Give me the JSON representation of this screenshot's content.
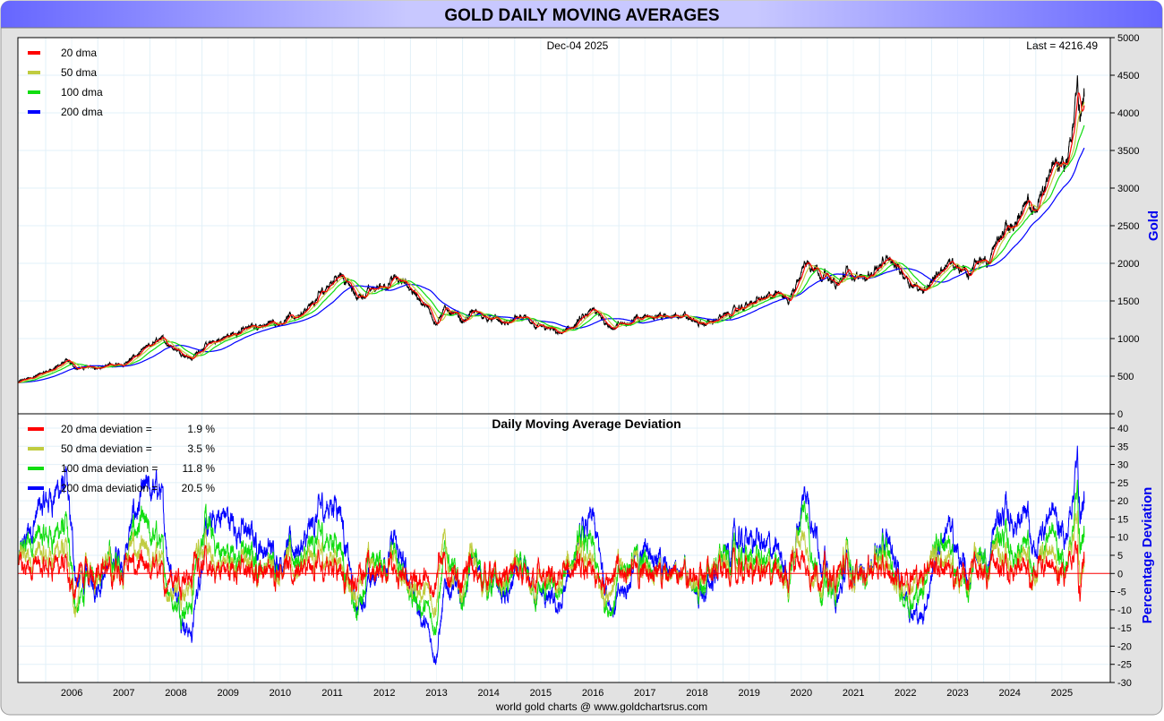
{
  "title": "GOLD DAILY MOVING AVERAGES",
  "footer": "world gold charts @ www.goldchartsrus.com",
  "chart_data": [
    {
      "type": "line",
      "title": "",
      "date_label": "Dec-04  2025",
      "last_label": "Last = 4216.49",
      "ylabel": "Gold",
      "ylim": [
        0,
        5000
      ],
      "yticks": [
        0,
        500,
        1000,
        1500,
        2000,
        2500,
        3000,
        3500,
        4000,
        4500,
        5000
      ],
      "xticks": [
        "2006",
        "2007",
        "2008",
        "2009",
        "2010",
        "2011",
        "2012",
        "2013",
        "2014",
        "2015",
        "2016",
        "2017",
        "2018",
        "2019",
        "2020",
        "2021",
        "2022",
        "2023",
        "2024",
        "2025"
      ],
      "xlim": [
        2005.48,
        2025.95
      ],
      "legend": [
        {
          "label": "20 dma",
          "color": "#ff0000"
        },
        {
          "label": "50 dma",
          "color": "#c0cc40"
        },
        {
          "label": "100 dma",
          "color": "#10dd10"
        },
        {
          "label": "200 dma",
          "color": "#0000ff"
        }
      ],
      "price_color": "#000000",
      "price_keypoints": [
        [
          2005.48,
          425
        ],
        [
          2006.0,
          550
        ],
        [
          2006.4,
          700
        ],
        [
          2006.6,
          600
        ],
        [
          2007.0,
          630
        ],
        [
          2007.5,
          660
        ],
        [
          2008.0,
          900
        ],
        [
          2008.2,
          1000
        ],
        [
          2008.8,
          730
        ],
        [
          2009.0,
          880
        ],
        [
          2009.9,
          1150
        ],
        [
          2010.5,
          1230
        ],
        [
          2011.0,
          1350
        ],
        [
          2011.65,
          1900
        ],
        [
          2011.95,
          1550
        ],
        [
          2012.7,
          1780
        ],
        [
          2013.0,
          1680
        ],
        [
          2013.5,
          1230
        ],
        [
          2013.7,
          1400
        ],
        [
          2014.0,
          1230
        ],
        [
          2014.2,
          1350
        ],
        [
          2014.9,
          1180
        ],
        [
          2015.0,
          1280
        ],
        [
          2015.9,
          1060
        ],
        [
          2016.5,
          1360
        ],
        [
          2016.9,
          1150
        ],
        [
          2017.7,
          1330
        ],
        [
          2017.95,
          1260
        ],
        [
          2018.1,
          1350
        ],
        [
          2018.6,
          1180
        ],
        [
          2019.0,
          1290
        ],
        [
          2019.7,
          1520
        ],
        [
          2020.2,
          1600
        ],
        [
          2020.25,
          1480
        ],
        [
          2020.6,
          2050
        ],
        [
          2021.2,
          1700
        ],
        [
          2021.4,
          1900
        ],
        [
          2021.6,
          1780
        ],
        [
          2022.2,
          2050
        ],
        [
          2022.8,
          1630
        ],
        [
          2023.3,
          2000
        ],
        [
          2023.75,
          1830
        ],
        [
          2023.85,
          2050
        ],
        [
          2024.1,
          2030
        ],
        [
          2024.3,
          2350
        ],
        [
          2024.85,
          2750
        ],
        [
          2024.95,
          2620
        ],
        [
          2025.3,
          3300
        ],
        [
          2025.6,
          3350
        ],
        [
          2025.8,
          4350
        ],
        [
          2025.85,
          4000
        ],
        [
          2025.93,
          4216.49
        ]
      ]
    },
    {
      "type": "line",
      "title": "Daily Moving Average Deviation",
      "ylabel": "Percentage Deviation",
      "ylim": [
        -30,
        40
      ],
      "yticks": [
        -30,
        -25,
        -20,
        -15,
        -10,
        -5,
        0,
        5,
        10,
        15,
        20,
        25,
        30,
        35,
        40
      ],
      "legend": [
        {
          "label": "20 dma deviation =",
          "value": "1.9 %",
          "color": "#ff0000"
        },
        {
          "label": "50 dma deviation =",
          "value": "3.5 %",
          "color": "#c0cc40"
        },
        {
          "label": "100 dma deviation =",
          "value": "11.8 %",
          "color": "#10dd10"
        },
        {
          "label": "200 dma deviation =",
          "value": "20.5 %",
          "color": "#0000ff"
        }
      ]
    }
  ]
}
